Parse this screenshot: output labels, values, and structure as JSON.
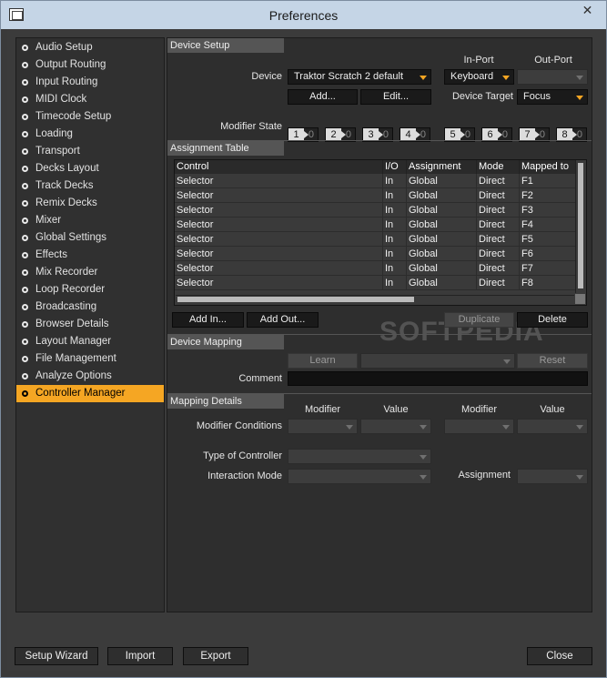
{
  "window": {
    "title": "Preferences"
  },
  "sidebar": {
    "items": [
      {
        "label": "Audio Setup"
      },
      {
        "label": "Output Routing"
      },
      {
        "label": "Input Routing"
      },
      {
        "label": "MIDI Clock"
      },
      {
        "label": "Timecode Setup"
      },
      {
        "label": "Loading"
      },
      {
        "label": "Transport"
      },
      {
        "label": "Decks Layout"
      },
      {
        "label": "Track Decks"
      },
      {
        "label": "Remix Decks"
      },
      {
        "label": "Mixer"
      },
      {
        "label": "Global Settings"
      },
      {
        "label": "Effects"
      },
      {
        "label": "Mix Recorder"
      },
      {
        "label": "Loop Recorder"
      },
      {
        "label": "Broadcasting"
      },
      {
        "label": "Browser Details"
      },
      {
        "label": "Layout Manager"
      },
      {
        "label": "File Management"
      },
      {
        "label": "Analyze Options"
      },
      {
        "label": "Controller Manager"
      }
    ],
    "active": "Controller Manager"
  },
  "device_setup": {
    "title": "Device Setup",
    "device_label": "Device",
    "device_value": "Traktor Scratch 2 default",
    "in_port_label": "In-Port",
    "in_port_value": "Keyboard",
    "out_port_label": "Out-Port",
    "out_port_value": "",
    "add_label": "Add...",
    "edit_label": "Edit...",
    "device_target_label": "Device Target",
    "device_target_value": "Focus",
    "modifier_state_label": "Modifier State",
    "modifiers": [
      {
        "n": "1",
        "v": "0"
      },
      {
        "n": "2",
        "v": "0"
      },
      {
        "n": "3",
        "v": "0"
      },
      {
        "n": "4",
        "v": "0"
      },
      {
        "n": "5",
        "v": "0"
      },
      {
        "n": "6",
        "v": "0"
      },
      {
        "n": "7",
        "v": "0"
      },
      {
        "n": "8",
        "v": "0"
      }
    ]
  },
  "assignment_table": {
    "title": "Assignment Table",
    "columns": [
      "Control",
      "I/O",
      "Assignment",
      "Mode",
      "Mapped to"
    ],
    "rows": [
      [
        "Selector",
        "In",
        "Global",
        "Direct",
        "F1"
      ],
      [
        "Selector",
        "In",
        "Global",
        "Direct",
        "F2"
      ],
      [
        "Selector",
        "In",
        "Global",
        "Direct",
        "F3"
      ],
      [
        "Selector",
        "In",
        "Global",
        "Direct",
        "F4"
      ],
      [
        "Selector",
        "In",
        "Global",
        "Direct",
        "F5"
      ],
      [
        "Selector",
        "In",
        "Global",
        "Direct",
        "F6"
      ],
      [
        "Selector",
        "In",
        "Global",
        "Direct",
        "F7"
      ],
      [
        "Selector",
        "In",
        "Global",
        "Direct",
        "F8"
      ]
    ],
    "add_in_label": "Add In...",
    "add_out_label": "Add Out...",
    "duplicate_label": "Duplicate",
    "delete_label": "Delete",
    "watermark": "SOFTPEDIA"
  },
  "device_mapping": {
    "title": "Device Mapping",
    "learn_label": "Learn",
    "reset_label": "Reset",
    "comment_label": "Comment",
    "comment_value": ""
  },
  "mapping_details": {
    "title": "Mapping Details",
    "modifier_label": "Modifier",
    "value_label": "Value",
    "modifier_conditions_label": "Modifier Conditions",
    "type_of_controller_label": "Type of Controller",
    "interaction_mode_label": "Interaction Mode",
    "assignment_label": "Assignment"
  },
  "footer": {
    "setup_wizard_label": "Setup Wizard",
    "import_label": "Import",
    "export_label": "Export",
    "close_label": "Close"
  },
  "colors": {
    "accent": "#f5a623",
    "background": "#3b3b3b",
    "panel": "#2e2e2e"
  }
}
